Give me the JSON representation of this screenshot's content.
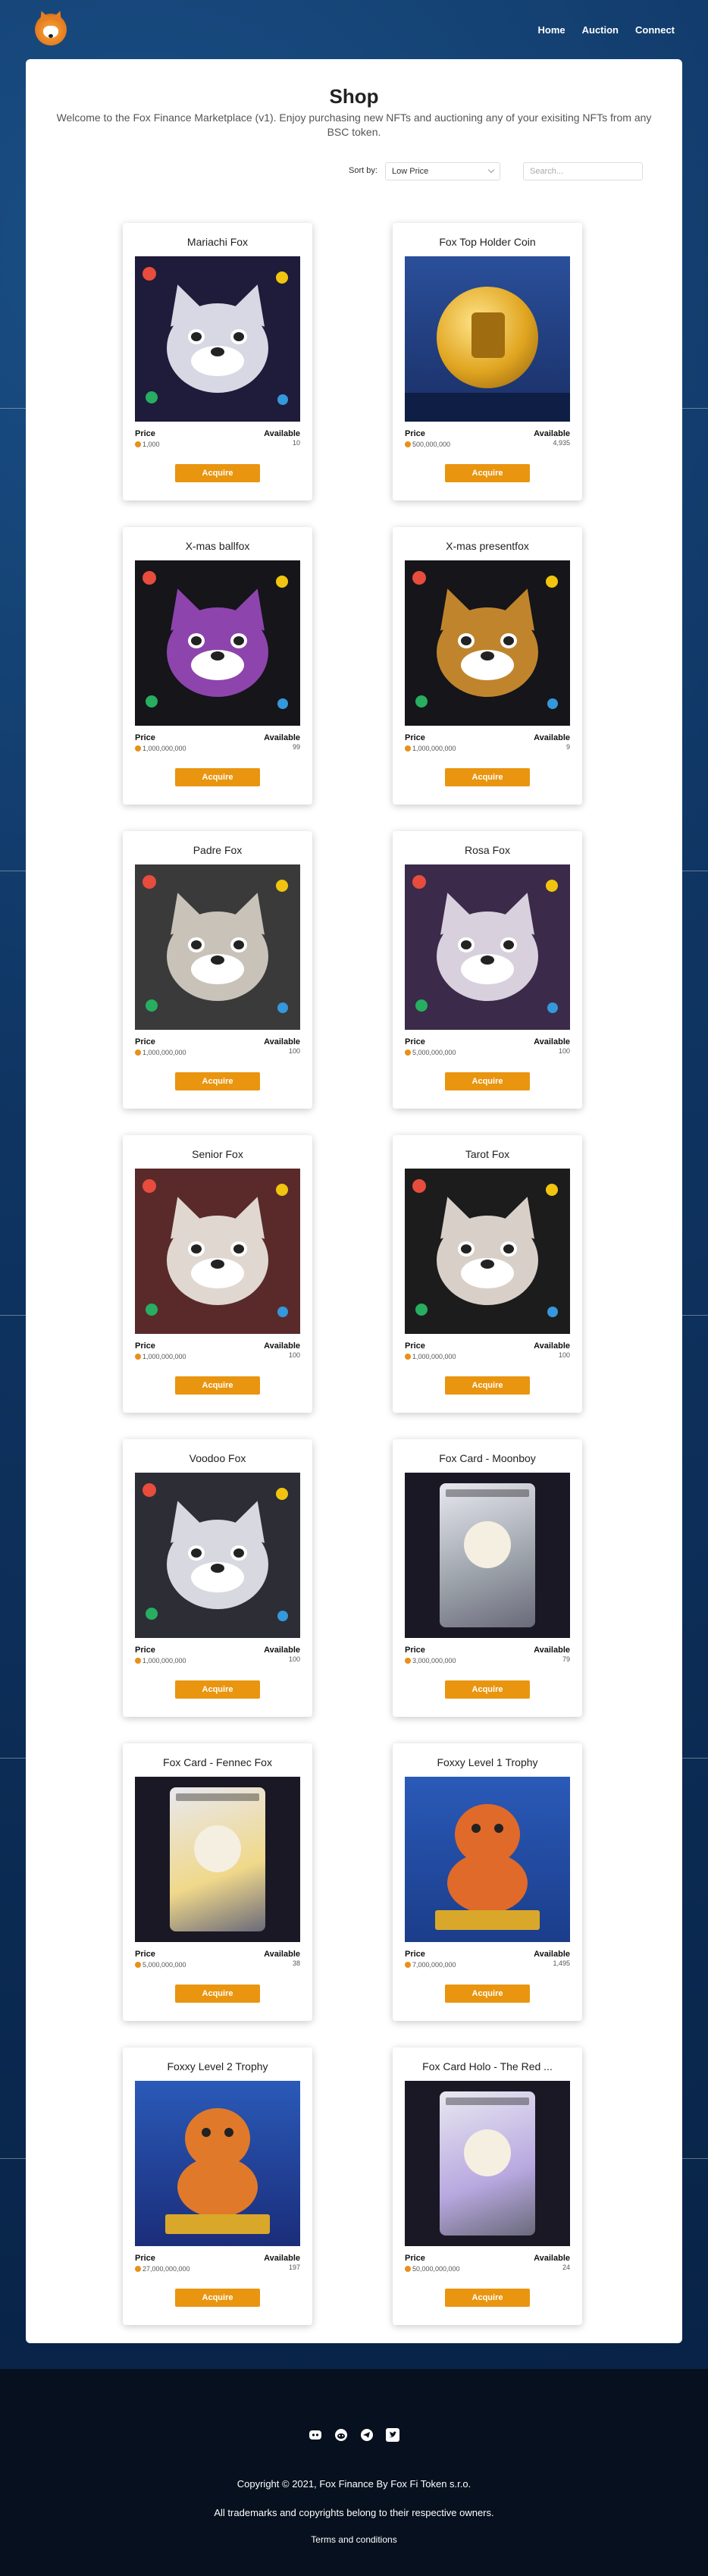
{
  "nav": {
    "logo": "fox-finance-logo",
    "links": [
      "Home",
      "Auction",
      "Connect"
    ]
  },
  "shop": {
    "title": "Shop",
    "subtitle": "Welcome to the Fox Finance Marketplace (v1). Enjoy purchasing new NFTs and auctioning any of your exisiting NFTs from any BSC token.",
    "sort_label": "Sort by:",
    "sort_value": "Low Price",
    "search_placeholder": "Search..."
  },
  "labels": {
    "price": "Price",
    "available": "Available",
    "acquire": "Acquire"
  },
  "products": [
    {
      "name": "Mariachi Fox",
      "price": "1,000",
      "available": "10",
      "art": "fox",
      "bg": "#1f1b3a",
      "fur": "#d8d8e4"
    },
    {
      "name": "Fox Top Holder Coin",
      "price": "500,000,000",
      "available": "4,935",
      "art": "coin",
      "bg": "#2a4f9a",
      "fur": "#e0a520"
    },
    {
      "name": "X-mas ballfox",
      "price": "1,000,000,000",
      "available": "99",
      "art": "fox",
      "bg": "#15151a",
      "fur": "#8e44ad"
    },
    {
      "name": "X-mas presentfox",
      "price": "1,000,000,000",
      "available": "9",
      "art": "fox",
      "bg": "#15151a",
      "fur": "#c0852c"
    },
    {
      "name": "Padre Fox",
      "price": "1,000,000,000",
      "available": "100",
      "art": "fox",
      "bg": "#3a3a3a",
      "fur": "#c8c2b8"
    },
    {
      "name": "Rosa Fox",
      "price": "5,000,000,000",
      "available": "100",
      "art": "fox",
      "bg": "#3b2a4a",
      "fur": "#d8d0dc"
    },
    {
      "name": "Senior Fox",
      "price": "1,000,000,000",
      "available": "100",
      "art": "fox",
      "bg": "#5a2a2a",
      "fur": "#e0d8d0"
    },
    {
      "name": "Tarot Fox",
      "price": "1,000,000,000",
      "available": "100",
      "art": "fox",
      "bg": "#1c1c1c",
      "fur": "#d8d0c8"
    },
    {
      "name": "Voodoo Fox",
      "price": "1,000,000,000",
      "available": "100",
      "art": "fox",
      "bg": "#2d2d36",
      "fur": "#d8d8e0"
    },
    {
      "name": "Fox Card - Moonboy",
      "price": "3,000,000,000",
      "available": "79",
      "art": "card",
      "bg": "#1a1824",
      "fur": "#9aa0a8"
    },
    {
      "name": "Fox Card - Fennec Fox",
      "price": "5,000,000,000",
      "available": "38",
      "art": "card",
      "bg": "#1a1824",
      "fur": "#f0d88a"
    },
    {
      "name": "Foxxy Level 1 Trophy",
      "price": "7,000,000,000",
      "available": "1,495",
      "art": "trophy",
      "bg": "#1b3d8a",
      "fur": "#e06a2a"
    },
    {
      "name": "Foxxy Level 2 Trophy",
      "price": "27,000,000,000",
      "available": "197",
      "art": "trophy",
      "bg": "#1b2d7a",
      "fur": "#e07a2a"
    },
    {
      "name": "Fox Card Holo - The Red ...",
      "price": "50,000,000,000",
      "available": "24",
      "art": "card",
      "bg": "#1a1824",
      "fur": "#b8a8e0"
    }
  ],
  "footer": {
    "social_icons": [
      "discord-icon",
      "reddit-icon",
      "telegram-icon",
      "twitter-icon"
    ],
    "copyright": "Copyright © 2021, Fox Finance By Fox Fi Token s.r.o.",
    "trademarks": "All trademarks and copyrights belong to their respective owners.",
    "terms": "Terms and conditions"
  },
  "colors": {
    "accent": "#e9950f",
    "background": "#0f3563",
    "footer": "#07101e"
  }
}
